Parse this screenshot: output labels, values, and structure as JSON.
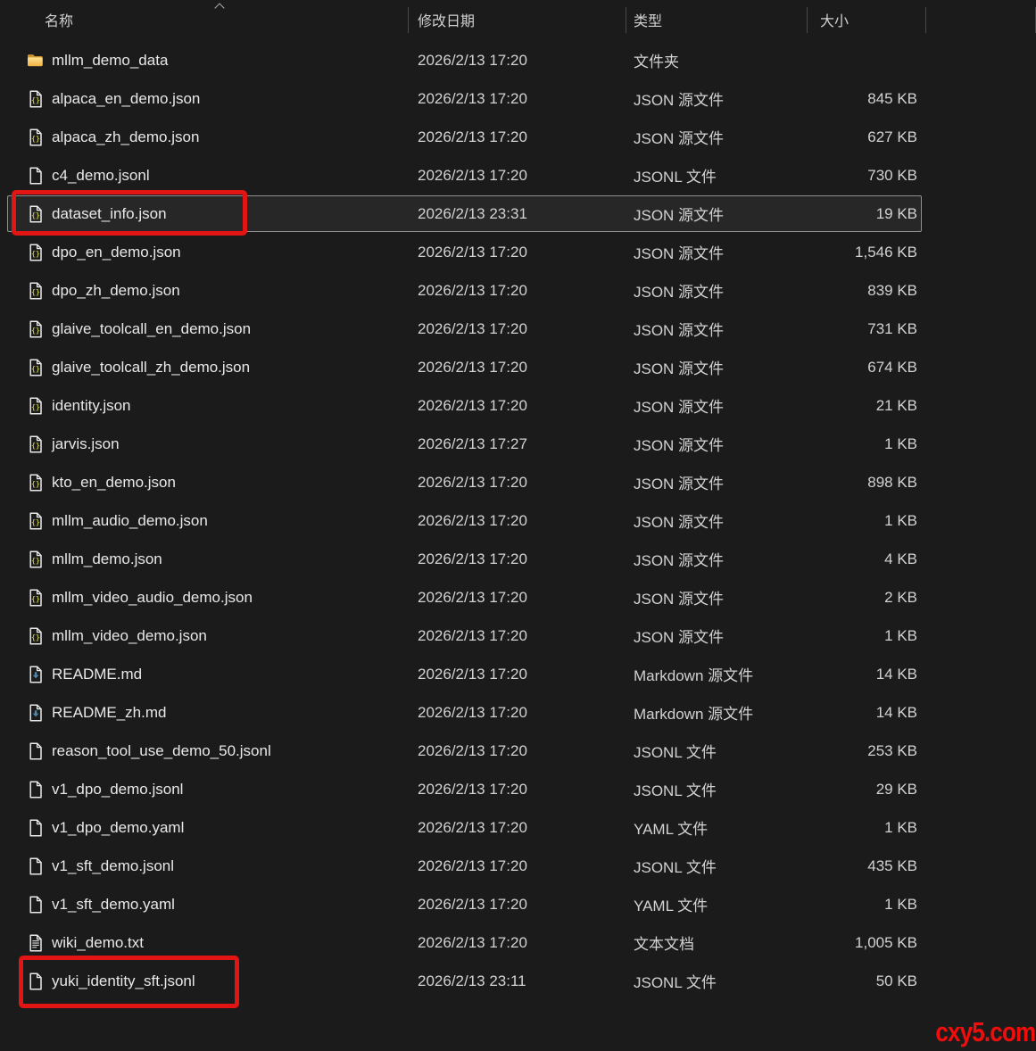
{
  "columns": {
    "name": "名称",
    "date": "修改日期",
    "type": "类型",
    "size": "大小"
  },
  "sort": {
    "column": "名称",
    "direction": "ascending"
  },
  "rows": [
    {
      "icon": "folder-icon",
      "name": "mllm_demo_data",
      "date": "2026/2/13 17:20",
      "type": "文件夹",
      "size": ""
    },
    {
      "icon": "json-file-icon",
      "name": "alpaca_en_demo.json",
      "date": "2026/2/13 17:20",
      "type": "JSON 源文件",
      "size": "845 KB"
    },
    {
      "icon": "json-file-icon",
      "name": "alpaca_zh_demo.json",
      "date": "2026/2/13 17:20",
      "type": "JSON 源文件",
      "size": "627 KB"
    },
    {
      "icon": "file-icon",
      "name": "c4_demo.jsonl",
      "date": "2026/2/13 17:20",
      "type": "JSONL 文件",
      "size": "730 KB"
    },
    {
      "icon": "json-file-icon",
      "name": "dataset_info.json",
      "date": "2026/2/13 23:31",
      "type": "JSON 源文件",
      "size": "19 KB",
      "selected": true
    },
    {
      "icon": "json-file-icon",
      "name": "dpo_en_demo.json",
      "date": "2026/2/13 17:20",
      "type": "JSON 源文件",
      "size": "1,546 KB"
    },
    {
      "icon": "json-file-icon",
      "name": "dpo_zh_demo.json",
      "date": "2026/2/13 17:20",
      "type": "JSON 源文件",
      "size": "839 KB"
    },
    {
      "icon": "json-file-icon",
      "name": "glaive_toolcall_en_demo.json",
      "date": "2026/2/13 17:20",
      "type": "JSON 源文件",
      "size": "731 KB"
    },
    {
      "icon": "json-file-icon",
      "name": "glaive_toolcall_zh_demo.json",
      "date": "2026/2/13 17:20",
      "type": "JSON 源文件",
      "size": "674 KB"
    },
    {
      "icon": "json-file-icon",
      "name": "identity.json",
      "date": "2026/2/13 17:20",
      "type": "JSON 源文件",
      "size": "21 KB"
    },
    {
      "icon": "json-file-icon",
      "name": "jarvis.json",
      "date": "2026/2/13 17:27",
      "type": "JSON 源文件",
      "size": "1 KB"
    },
    {
      "icon": "json-file-icon",
      "name": "kto_en_demo.json",
      "date": "2026/2/13 17:20",
      "type": "JSON 源文件",
      "size": "898 KB"
    },
    {
      "icon": "json-file-icon",
      "name": "mllm_audio_demo.json",
      "date": "2026/2/13 17:20",
      "type": "JSON 源文件",
      "size": "1 KB"
    },
    {
      "icon": "json-file-icon",
      "name": "mllm_demo.json",
      "date": "2026/2/13 17:20",
      "type": "JSON 源文件",
      "size": "4 KB"
    },
    {
      "icon": "json-file-icon",
      "name": "mllm_video_audio_demo.json",
      "date": "2026/2/13 17:20",
      "type": "JSON 源文件",
      "size": "2 KB"
    },
    {
      "icon": "json-file-icon",
      "name": "mllm_video_demo.json",
      "date": "2026/2/13 17:20",
      "type": "JSON 源文件",
      "size": "1 KB"
    },
    {
      "icon": "markdown-file-icon",
      "name": "README.md",
      "date": "2026/2/13 17:20",
      "type": "Markdown 源文件",
      "size": "14 KB"
    },
    {
      "icon": "markdown-file-icon",
      "name": "README_zh.md",
      "date": "2026/2/13 17:20",
      "type": "Markdown 源文件",
      "size": "14 KB"
    },
    {
      "icon": "file-icon",
      "name": "reason_tool_use_demo_50.jsonl",
      "date": "2026/2/13 17:20",
      "type": "JSONL 文件",
      "size": "253 KB"
    },
    {
      "icon": "file-icon",
      "name": "v1_dpo_demo.jsonl",
      "date": "2026/2/13 17:20",
      "type": "JSONL 文件",
      "size": "29 KB"
    },
    {
      "icon": "file-icon",
      "name": "v1_dpo_demo.yaml",
      "date": "2026/2/13 17:20",
      "type": "YAML 文件",
      "size": "1 KB"
    },
    {
      "icon": "file-icon",
      "name": "v1_sft_demo.jsonl",
      "date": "2026/2/13 17:20",
      "type": "JSONL 文件",
      "size": "435 KB"
    },
    {
      "icon": "file-icon",
      "name": "v1_sft_demo.yaml",
      "date": "2026/2/13 17:20",
      "type": "YAML 文件",
      "size": "1 KB"
    },
    {
      "icon": "text-file-icon",
      "name": "wiki_demo.txt",
      "date": "2026/2/13 17:20",
      "type": "文本文档",
      "size": "1,005 KB"
    },
    {
      "icon": "file-icon",
      "name": "yuki_identity_sft.jsonl",
      "date": "2026/2/13 23:11",
      "type": "JSONL 文件",
      "size": "50 KB"
    }
  ],
  "annotations": [
    {
      "target": "dataset_info.json"
    },
    {
      "target": "yuki_identity_sft.jsonl"
    }
  ],
  "watermark": "cxy5.com",
  "colors": {
    "background": "#1b1b1b",
    "text": "#e2e2e2",
    "annotation_red": "#e31414",
    "watermark_red": "#f20d0d",
    "folder_yellow": "#f3bb4e",
    "json_braces": "#b9ba45",
    "markdown_arrow": "#4e87ab"
  }
}
